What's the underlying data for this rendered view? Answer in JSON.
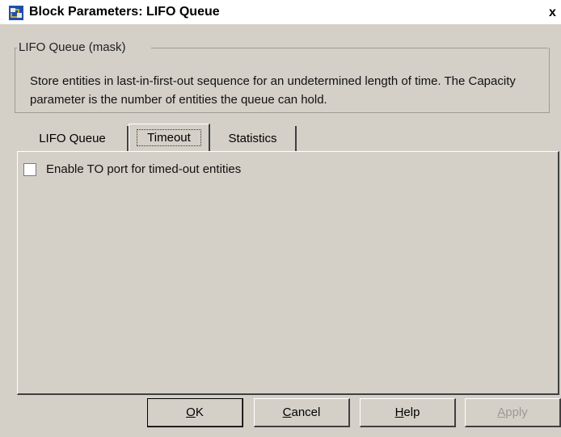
{
  "window": {
    "title": "Block Parameters: LIFO Queue",
    "close_label": "x"
  },
  "group": {
    "legend": "LIFO Queue (mask)",
    "description": "Store entities in last-in-first-out sequence for an undetermined length of time. The Capacity parameter is the number of entities the queue can hold."
  },
  "tabs": [
    {
      "label": "LIFO Queue",
      "active": false
    },
    {
      "label": "Timeout",
      "active": true
    },
    {
      "label": "Statistics",
      "active": false
    }
  ],
  "timeout": {
    "enable_to_port_label": "Enable TO port for timed-out entities",
    "enable_to_port_checked": false
  },
  "buttons": {
    "ok_first": "O",
    "ok_rest": "K",
    "cancel_first": "C",
    "cancel_rest": "ancel",
    "help_first": "H",
    "help_rest": "elp",
    "apply_first": "A",
    "apply_rest": "pply"
  },
  "colors": {
    "dialog_bg": "#d4d0c8",
    "disabled_text": "#9c9a94"
  }
}
